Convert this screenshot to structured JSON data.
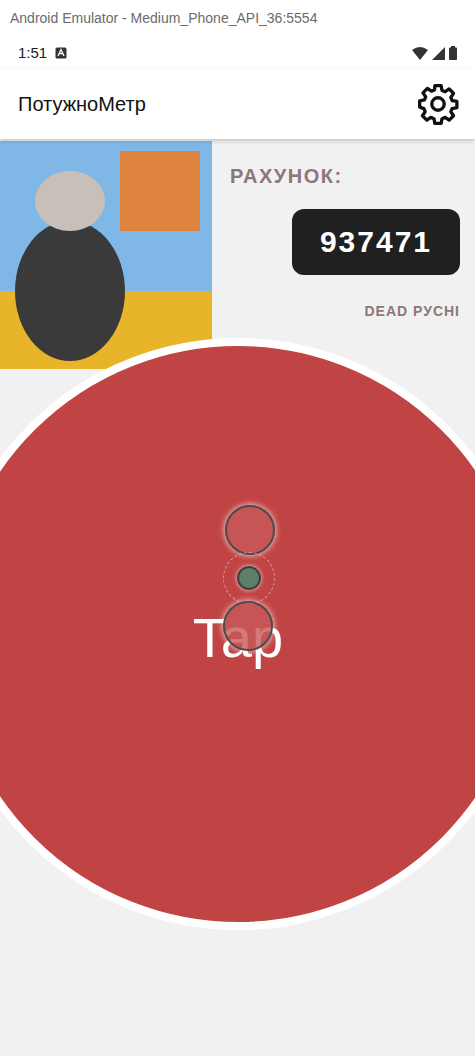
{
  "window": {
    "title": "Android Emulator - Medium_Phone_API_36:5554"
  },
  "status_bar": {
    "time": "1:51"
  },
  "app_bar": {
    "title": "ПотужноМетр"
  },
  "score": {
    "label": "РАХУНОК:",
    "value": "937471",
    "caption": "DEAD РУСНІ"
  },
  "tap_button": {
    "label": "Tap"
  }
}
